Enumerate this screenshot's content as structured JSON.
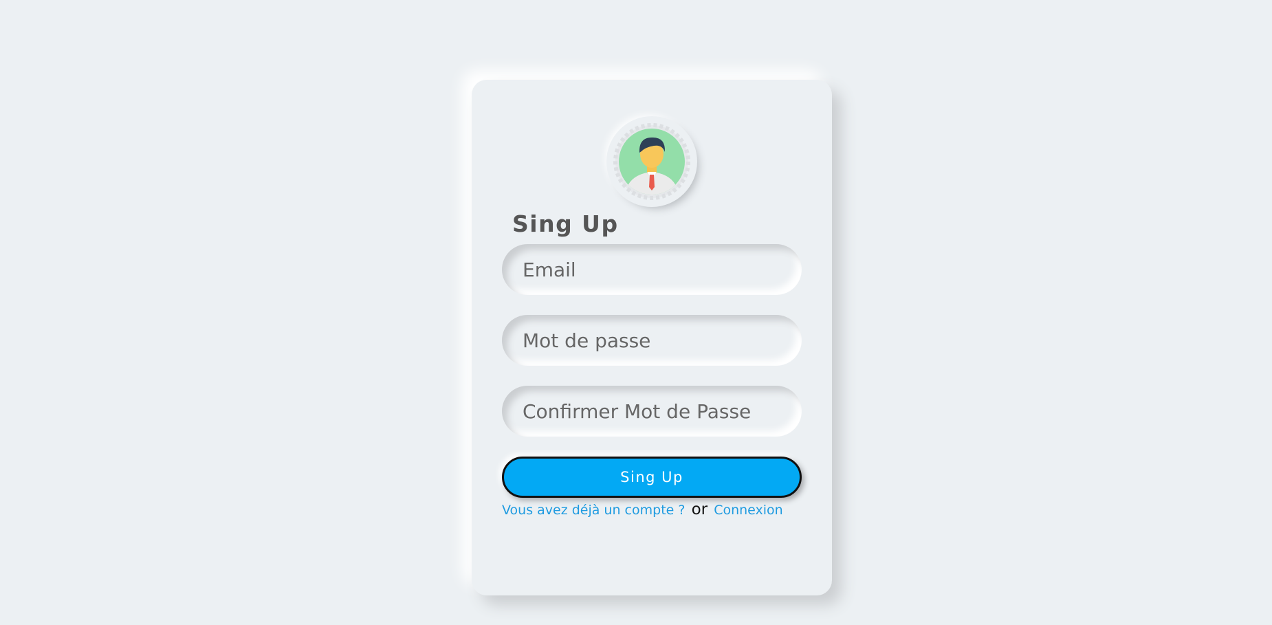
{
  "form": {
    "title": "Sing Up",
    "email_placeholder": "Email",
    "password_placeholder": "Mot de passe",
    "confirm_placeholder": "Confirmer Mot de Passe",
    "submit_label": "Sing Up",
    "already_account_link": "Vous avez déjà un compte ?",
    "or_text": "or",
    "login_link": "Connexion"
  },
  "colors": {
    "background": "#ecf0f3",
    "button": "#03a9f4",
    "link": "#1f9be0",
    "title": "#555555"
  },
  "icons": {
    "avatar": "user-avatar-icon"
  }
}
